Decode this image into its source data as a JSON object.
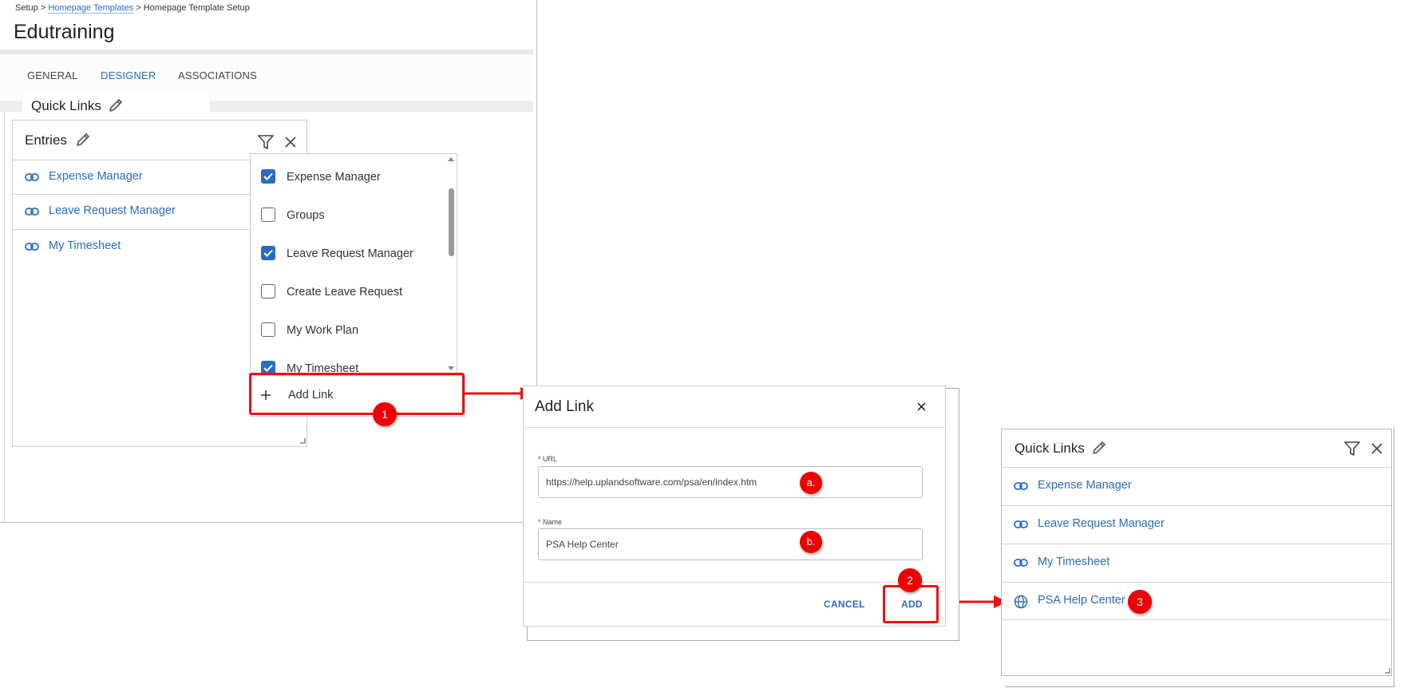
{
  "breadcrumb": {
    "root": "Setup",
    "sep": ">",
    "link": "Homepage Templates",
    "current": "Homepage Template Setup"
  },
  "page": {
    "title": "Edutraining"
  },
  "tabs": [
    {
      "label": "GENERAL",
      "active": false
    },
    {
      "label": "DESIGNER",
      "active": true
    },
    {
      "label": "ASSOCIATIONS",
      "active": false
    }
  ],
  "quick_links_header": {
    "title": "Quick Links"
  },
  "entries_widget": {
    "title": "Entries",
    "items": [
      {
        "label": "Expense Manager",
        "icon": "link-icon"
      },
      {
        "label": "Leave Request Manager",
        "icon": "link-icon"
      },
      {
        "label": "My Timesheet",
        "icon": "link-icon"
      }
    ]
  },
  "dropdown": {
    "options": [
      {
        "label": "Expense Manager",
        "checked": true
      },
      {
        "label": "Groups",
        "checked": false
      },
      {
        "label": "Leave Request Manager",
        "checked": true
      },
      {
        "label": "Create Leave Request",
        "checked": false
      },
      {
        "label": "My Work Plan",
        "checked": false
      },
      {
        "label": "My Timesheet",
        "checked": true
      }
    ],
    "add_link_label": "Add Link"
  },
  "add_link_dialog": {
    "title": "Add Link",
    "close": "×",
    "url_label": "* URL",
    "url_value": "https://help.uplandsoftware.com/psa/en/index.htm",
    "name_label": "* Name",
    "name_value": "PSA Help Center",
    "cancel_label": "CANCEL",
    "add_label": "ADD"
  },
  "result_widget": {
    "title": "Quick Links",
    "items": [
      {
        "label": "Expense Manager",
        "icon": "link-icon"
      },
      {
        "label": "Leave Request Manager",
        "icon": "link-icon"
      },
      {
        "label": "My Timesheet",
        "icon": "link-icon"
      },
      {
        "label": "PSA Help Center",
        "icon": "globe-icon"
      }
    ]
  },
  "callouts": {
    "step1": "1",
    "step2": "2",
    "step3": "3",
    "a": "a.",
    "b": "b."
  },
  "colors": {
    "accent": "#2a6cc1",
    "callout_red": "#e01010",
    "checkbox_blue": "#2a6cc1"
  }
}
